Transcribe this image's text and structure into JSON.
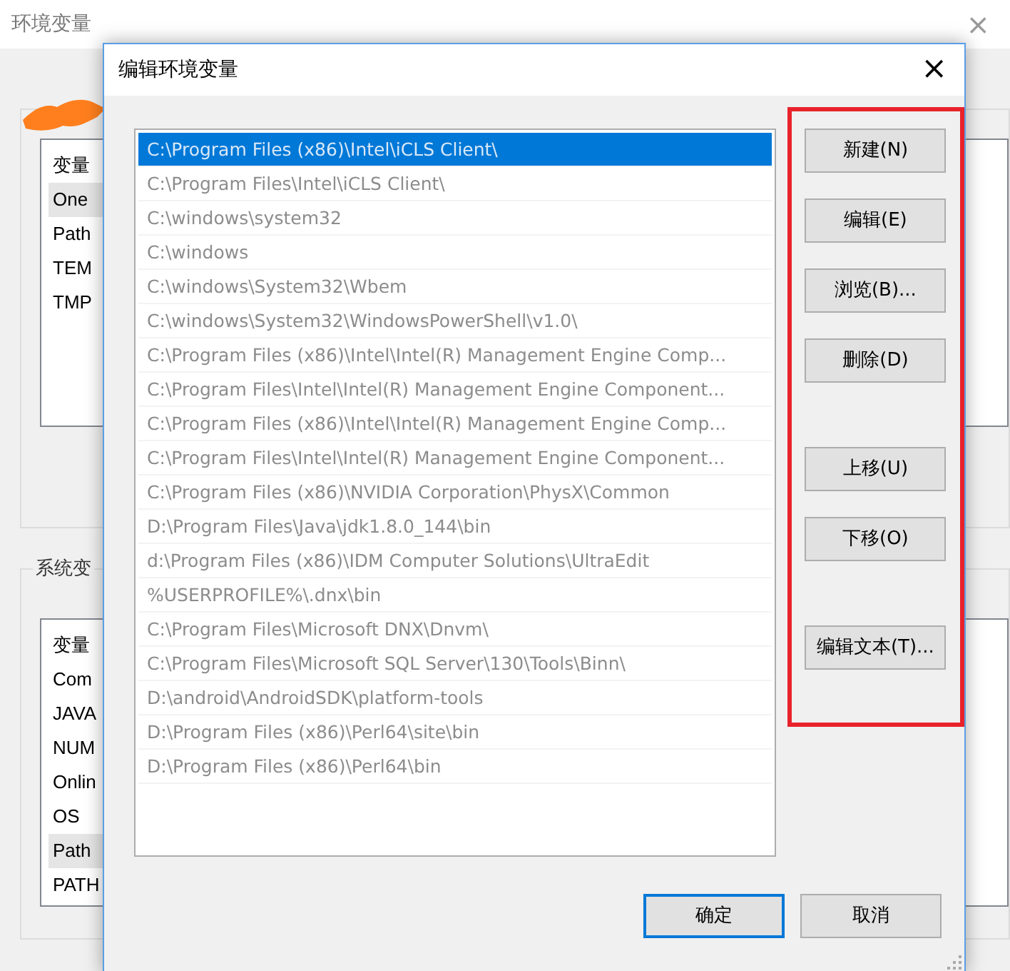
{
  "window": {
    "title": "环境变量",
    "close": "×"
  },
  "user_variables": {
    "header": "变量",
    "items": [
      {
        "name": "One",
        "selected": true
      },
      {
        "name": "Path",
        "selected": false
      },
      {
        "name": "TEM",
        "selected": false
      },
      {
        "name": "TMP",
        "selected": false
      }
    ]
  },
  "system_variables": {
    "title": "系统变",
    "header": "变量",
    "items": [
      {
        "name": "Com",
        "selected": false
      },
      {
        "name": "JAVA",
        "selected": false
      },
      {
        "name": "NUM",
        "selected": false
      },
      {
        "name": "Onlin",
        "selected": false
      },
      {
        "name": "OS",
        "selected": false
      },
      {
        "name": "Path",
        "selected": true
      },
      {
        "name": "PATH",
        "selected": false
      }
    ]
  },
  "dialog": {
    "title": "编辑环境变量",
    "close": "×",
    "paths": [
      {
        "text": "C:\\Program Files (x86)\\Intel\\iCLS Client\\",
        "selected": true
      },
      {
        "text": "C:\\Program Files\\Intel\\iCLS Client\\",
        "selected": false
      },
      {
        "text": "C:\\windows\\system32",
        "selected": false
      },
      {
        "text": "C:\\windows",
        "selected": false
      },
      {
        "text": "C:\\windows\\System32\\Wbem",
        "selected": false
      },
      {
        "text": "C:\\windows\\System32\\WindowsPowerShell\\v1.0\\",
        "selected": false
      },
      {
        "text": "C:\\Program Files (x86)\\Intel\\Intel(R) Management Engine Comp...",
        "selected": false
      },
      {
        "text": "C:\\Program Files\\Intel\\Intel(R) Management Engine Component...",
        "selected": false
      },
      {
        "text": "C:\\Program Files (x86)\\Intel\\Intel(R) Management Engine Comp...",
        "selected": false
      },
      {
        "text": "C:\\Program Files\\Intel\\Intel(R) Management Engine Component...",
        "selected": false
      },
      {
        "text": "C:\\Program Files (x86)\\NVIDIA Corporation\\PhysX\\Common",
        "selected": false
      },
      {
        "text": "D:\\Program Files\\Java\\jdk1.8.0_144\\bin",
        "selected": false
      },
      {
        "text": "d:\\Program Files (x86)\\IDM Computer Solutions\\UltraEdit",
        "selected": false
      },
      {
        "text": "%USERPROFILE%\\.dnx\\bin",
        "selected": false
      },
      {
        "text": "C:\\Program Files\\Microsoft DNX\\Dnvm\\",
        "selected": false
      },
      {
        "text": "C:\\Program Files\\Microsoft SQL Server\\130\\Tools\\Binn\\",
        "selected": false
      },
      {
        "text": "D:\\android\\AndroidSDK\\platform-tools",
        "selected": false
      },
      {
        "text": "D:\\Program Files (x86)\\Perl64\\site\\bin",
        "selected": false
      },
      {
        "text": "D:\\Program Files (x86)\\Perl64\\bin",
        "selected": false
      }
    ],
    "button_groups": [
      {
        "buttons": [
          "新建(N)",
          "编辑(E)",
          "浏览(B)...",
          "删除(D)"
        ]
      },
      {
        "buttons": [
          "上移(U)",
          "下移(O)"
        ]
      },
      {
        "buttons": [
          "编辑文本(T)..."
        ]
      }
    ],
    "footer_buttons": [
      {
        "label": "确定",
        "default": true
      },
      {
        "label": "取消",
        "default": false
      }
    ]
  }
}
